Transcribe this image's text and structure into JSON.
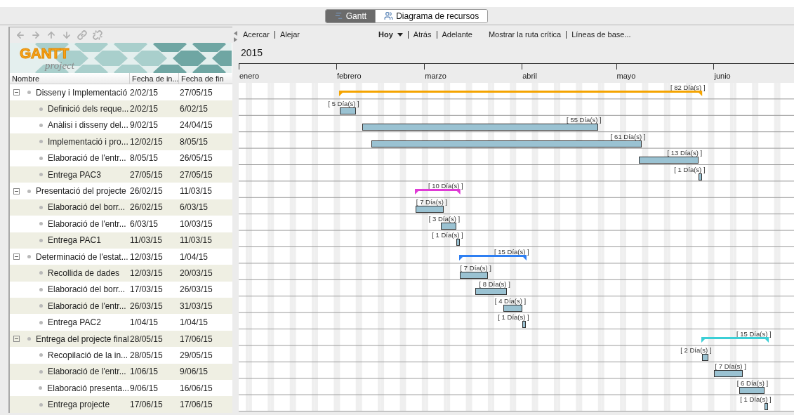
{
  "tabs": [
    {
      "label": "Gantt",
      "selected": true,
      "kind": "gantt"
    },
    {
      "label": "Diagrama de recursos",
      "selected": false,
      "kind": "resources"
    }
  ],
  "logo": {
    "title": "GANTT",
    "subtitle": "project"
  },
  "table": {
    "columns": [
      "Nombre",
      "Fecha de in...",
      "Fecha de fin"
    ]
  },
  "chart_toolbar": {
    "zoom": [
      "Acercar",
      "Alejar"
    ],
    "today": "Hoy",
    "nav": [
      "Atrás",
      "Adelante"
    ],
    "extra": [
      "Mostrar la ruta crítica",
      "Líneas de base..."
    ]
  },
  "timeline": {
    "year": "2015",
    "months": [
      "enero",
      "febrero",
      "marzo",
      "abril",
      "mayo",
      "junio"
    ]
  },
  "tasks": [
    {
      "name": "Disseny i Implementació",
      "start": "2/02/15",
      "end": "27/05/15",
      "duration": "[ 82 Día(s) ]",
      "color": "#f5a400",
      "expanded": true,
      "children": [
        {
          "name": "Definició dels reque...",
          "start": "2/02/15",
          "end": "6/02/15",
          "duration": "[ 5 Día(s) ]"
        },
        {
          "name": "Anàlisi i disseny del...",
          "start": "9/02/15",
          "end": "24/04/15",
          "duration": "[ 55 Día(s) ]"
        },
        {
          "name": "Implementació i pro...",
          "start": "12/02/15",
          "end": "8/05/15",
          "duration": "[ 61 Día(s) ]"
        },
        {
          "name": "Elaboració de l'entr...",
          "start": "8/05/15",
          "end": "26/05/15",
          "duration": "[ 13 Día(s) ]"
        },
        {
          "name": "Entrega PAC3",
          "start": "27/05/15",
          "end": "27/05/15",
          "duration": "[ 1 Día(s) ]"
        }
      ]
    },
    {
      "name": "Presentació del projecte",
      "start": "26/02/15",
      "end": "11/03/15",
      "duration": "[ 10 Día(s) ]",
      "color": "#e03ad6",
      "expanded": true,
      "children": [
        {
          "name": "Elaboració del borr...",
          "start": "26/02/15",
          "end": "6/03/15",
          "duration": "[ 7 Día(s) ]"
        },
        {
          "name": "Elaboració de l'entr...",
          "start": "6/03/15",
          "end": "10/03/15",
          "duration": "[ 3 Día(s) ]"
        },
        {
          "name": "Entrega PAC1",
          "start": "11/03/15",
          "end": "11/03/15",
          "duration": "[ 1 Día(s) ]"
        }
      ]
    },
    {
      "name": "Determinació de l'estat...",
      "start": "12/03/15",
      "end": "1/04/15",
      "duration": "[ 15 Día(s) ]",
      "color": "#2e7ff2",
      "expanded": true,
      "children": [
        {
          "name": "Recollida de dades",
          "start": "12/03/15",
          "end": "20/03/15",
          "duration": "[ 7 Día(s) ]"
        },
        {
          "name": "Elaboració del borr...",
          "start": "17/03/15",
          "end": "26/03/15",
          "duration": "[ 8 Día(s) ]"
        },
        {
          "name": "Elaboració de l'entr...",
          "start": "26/03/15",
          "end": "31/03/15",
          "duration": "[ 4 Día(s) ]"
        },
        {
          "name": "Entrega PAC2",
          "start": "1/04/15",
          "end": "1/04/15",
          "duration": "[ 1 Día(s) ]"
        }
      ]
    },
    {
      "name": "Entrega del projecte final",
      "start": "28/05/15",
      "end": "17/06/15",
      "duration": "[ 15 Día(s) ]",
      "color": "#3ccfd6",
      "expanded": true,
      "children": [
        {
          "name": "Recopilació de la in...",
          "start": "28/05/15",
          "end": "29/05/15",
          "duration": "[ 2 Día(s) ]"
        },
        {
          "name": "Elaboració de l'entr...",
          "start": "1/06/15",
          "end": "9/06/15",
          "duration": "[ 7 Día(s) ]"
        },
        {
          "name": "Elaboració presenta...",
          "start": "9/06/15",
          "end": "16/06/15",
          "duration": "[ 6 Día(s) ]"
        },
        {
          "name": "Entrega projecte",
          "start": "17/06/15",
          "end": "17/06/15",
          "duration": "[ 1 Día(s) ]"
        }
      ]
    }
  ]
}
